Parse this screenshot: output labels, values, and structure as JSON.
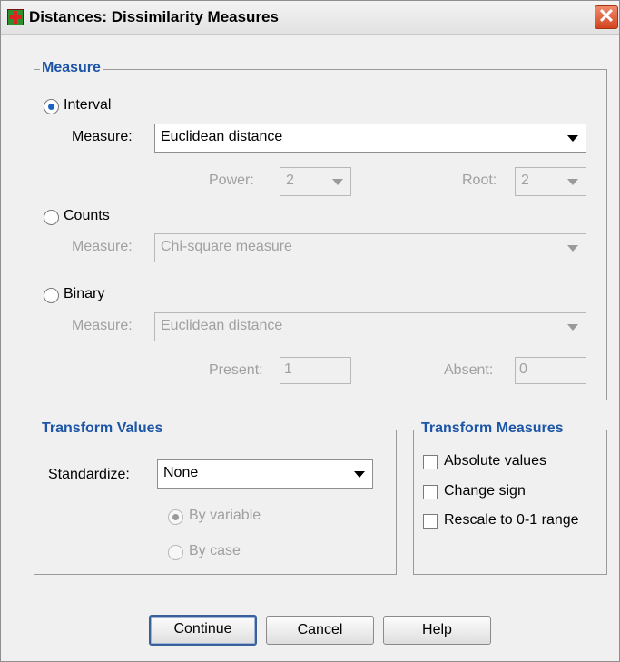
{
  "window": {
    "title": "Distances: Dissimilarity Measures",
    "close_glyph": "✕"
  },
  "measure": {
    "legend": "Measure",
    "interval": {
      "label": "Interval",
      "measure_label": "Measure:",
      "measure_value": "Euclidean distance",
      "power_label": "Power:",
      "power_value": "2",
      "root_label": "Root:",
      "root_value": "2"
    },
    "counts": {
      "label": "Counts",
      "measure_label": "Measure:",
      "measure_value": "Chi-square measure"
    },
    "binary": {
      "label": "Binary",
      "measure_label": "Measure:",
      "measure_value": "Euclidean distance",
      "present_label": "Present:",
      "present_value": "1",
      "absent_label": "Absent:",
      "absent_value": "0"
    },
    "selected": "interval"
  },
  "transform_values": {
    "legend": "Transform Values",
    "standardize_label": "Standardize:",
    "standardize_value": "None",
    "by_variable": "By variable",
    "by_case": "By case",
    "selected": "by_variable"
  },
  "transform_measures": {
    "legend": "Transform Measures",
    "options": [
      {
        "label": "Absolute values",
        "checked": false
      },
      {
        "label": "Change sign",
        "checked": false
      },
      {
        "label": "Rescale to 0-1 range",
        "checked": false
      }
    ]
  },
  "buttons": {
    "continue": "Continue",
    "cancel": "Cancel",
    "help": "Help"
  },
  "colors": {
    "legend": "#1d56a6",
    "selected_radio": "#1a62c6",
    "disabled_text": "#a0a0a0"
  }
}
